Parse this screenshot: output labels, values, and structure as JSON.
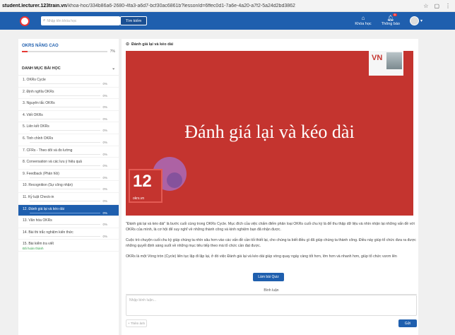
{
  "browser": {
    "url": "student.lecturer.123train.vn/khoa-hoc/334b86a6-2680-4fa3-a6d7-bcf30ac6861b?lessonId=6ffec0d1-7a6e-4a20-a7f2-5a24d2bd3862",
    "url_domain": "student.lecturer.123train.vn",
    "url_path": "/khoa-hoc/334b86a6-2680-4fa3-a6d7-bcf30ac6861b?lessonId=6ffec0d1-7a6e-4a20-a7f2-5a24d2bd3862"
  },
  "topnav": {
    "search_placeholder": "Nhập tên khóa học",
    "search_button": "Tìm kiếm",
    "courses_label": "Khóa học",
    "notifications_label": "Thông báo",
    "notification_count": "0"
  },
  "sidebar": {
    "course_title": "OKRS NÂNG CAO",
    "course_progress": "7%",
    "course_progress_value": 7,
    "section_title": "DANH MỤC BÀI HỌC",
    "lessons": [
      {
        "label": "1.  OKRs Cycle",
        "pct": "0%"
      },
      {
        "label": "2.  Định nghĩa OKRs",
        "pct": "0%"
      },
      {
        "label": "3.  Nguyên tắc OKRs",
        "pct": "0%"
      },
      {
        "label": "4.  Viết OKRs",
        "pct": "0%"
      },
      {
        "label": "5.  Liên kết OKRs",
        "pct": "0%"
      },
      {
        "label": "6.  Tinh chỉnh OKRs",
        "pct": "0%"
      },
      {
        "label": "7.  CFRs - Theo dõi và đo lường",
        "pct": "0%"
      },
      {
        "label": "8.  Conversation và các lưu ý hiệu quả",
        "pct": "0%"
      },
      {
        "label": "9.  Feedback (Phản hồi)",
        "pct": "0%"
      },
      {
        "label": "10.  Recognition (Sự công nhận)",
        "pct": "0%"
      },
      {
        "label": "11.  Kỷ luật Check-in",
        "pct": "0%"
      },
      {
        "label": "12.  Đánh giá lại và kéo dài",
        "pct": "0%"
      },
      {
        "label": "13.  Văn hóa OKRs",
        "pct": "0%"
      },
      {
        "label": "14.  Bài thi trắc nghiệm kiến thức",
        "pct": "0%"
      },
      {
        "label": "15.  Bài kiểm tra viết",
        "pct": "",
        "status": "Đã hoàn thành"
      }
    ]
  },
  "content": {
    "lesson_title": "Đánh giá lại và kéo dài",
    "video_title": "Đánh giá lại và kéo dài",
    "video_number": "12",
    "video_site": "okrs.vn",
    "video_logo": "VN",
    "paragraphs": [
      "\"Đánh giá lại và kéo dài\" là bước cuối cùng trong OKRs Cycle. Mục đích của việc chấm điểm phân loại OKRs cuối chu kỳ là để thu thập dữ liệu và nhìn nhận lại những vấn đề với OKRs của mình, là cơ hội để suy nghĩ về những thành công và kinh nghiệm bạn đã nhận được.",
      "Cuộc trò chuyện cuối chu kỳ giúp chúng ta nhìn sâu hơn vào các vấn đề cần tối thiết lại, cho chúng ta biết điều gì đã giúp chúng ta thành công. Điều này giúp tổ chức đưa ra được những quyết định sáng suốt về những mục tiêu tiếp theo mà tổ chức cần đạt được.",
      "OKRs là một Vòng tròn (Cycle) liên tục lặp đi lặp lại, ở đó việc Đánh giá lại và kéo dài giúp vòng quay ngày càng tốt hơn, lớn hơn và nhanh hơn, giúp tổ chức vươn lên"
    ],
    "quiz_button": "Làm bài Quiz",
    "comments_heading": "Bình luận",
    "comment_placeholder": "Nhập bình luận...",
    "attach_label": "+ Thêm ảnh",
    "send_label": "Gửi"
  },
  "colors": {
    "primary": "#1f5fae",
    "video_bg": "#c4342f",
    "progress": "#e53935",
    "done": "#2e9e47"
  }
}
